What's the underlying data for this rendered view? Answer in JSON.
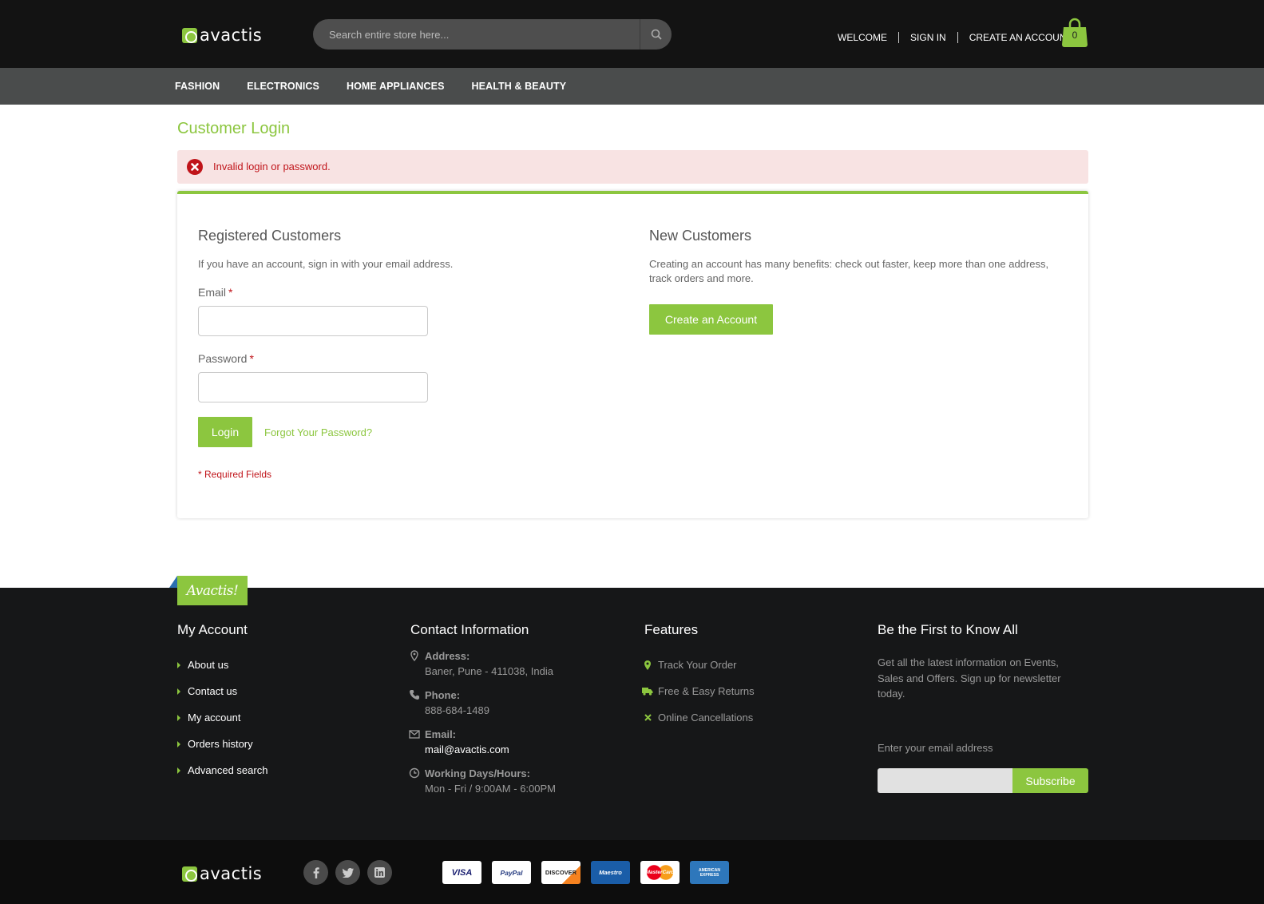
{
  "header": {
    "logo_text": "avactis",
    "search_placeholder": "Search entire store here...",
    "links": {
      "welcome": "WELCOME",
      "sign_in": "SIGN IN",
      "create_account": "CREATE AN ACCOUNT"
    },
    "cart_count": "0"
  },
  "nav": {
    "items": [
      "FASHION",
      "ELECTRONICS",
      "HOME APPLIANCES",
      "HEALTH & BEAUTY"
    ]
  },
  "page": {
    "title": "Customer Login",
    "alert": "Invalid login or password.",
    "registered": {
      "title": "Registered Customers",
      "desc": "If you have an account, sign in with your email address.",
      "email_label": "Email",
      "password_label": "Password",
      "required_star": "*",
      "email_value": "",
      "password_value": "",
      "login_button": "Login",
      "forgot_link": "Forgot Your Password?",
      "required_note": "* Required Fields"
    },
    "new_customers": {
      "title": "New Customers",
      "desc": "Creating an account has many benefits: check out faster, keep more than one address, track orders and more.",
      "create_button": "Create an Account"
    }
  },
  "footer": {
    "tab_label": "Avactis!",
    "my_account": {
      "title": "My Account",
      "items": [
        "About us",
        "Contact us",
        "My account",
        "Orders history",
        "Advanced search"
      ]
    },
    "contact": {
      "title": "Contact Information",
      "address_label": "Address:",
      "address_value": "Baner, Pune - 411038, India",
      "phone_label": "Phone:",
      "phone_value": "888-684-1489",
      "email_label": "Email:",
      "email_value": "mail@avactis.com",
      "hours_label": "Working Days/Hours:",
      "hours_value": "Mon - Fri / 9:00AM - 6:00PM"
    },
    "features": {
      "title": "Features",
      "items": [
        "Track Your Order",
        "Free & Easy Returns",
        "Online Cancellations"
      ]
    },
    "newsletter": {
      "title": "Be the First to Know All",
      "desc": "Get all the latest information on Events, Sales and Offers. Sign up for newsletter today.",
      "label": "Enter your email address",
      "input_value": "",
      "subscribe_button": "Subscribe"
    }
  },
  "bottom": {
    "logo_text": "avactis",
    "social_icons": [
      "facebook-icon",
      "twitter-icon",
      "linkedin-icon"
    ],
    "payment_labels": [
      "VISA",
      "PayPal",
      "DISCOVER",
      "Maestro",
      "MasterCard",
      "AMERICAN EXPRESS"
    ]
  },
  "colors": {
    "accent": "#8cc63f",
    "error": "#c0141a",
    "header_bg": "#131313",
    "nav_bg": "#4a4c4c",
    "footer_bg": "#161718"
  }
}
